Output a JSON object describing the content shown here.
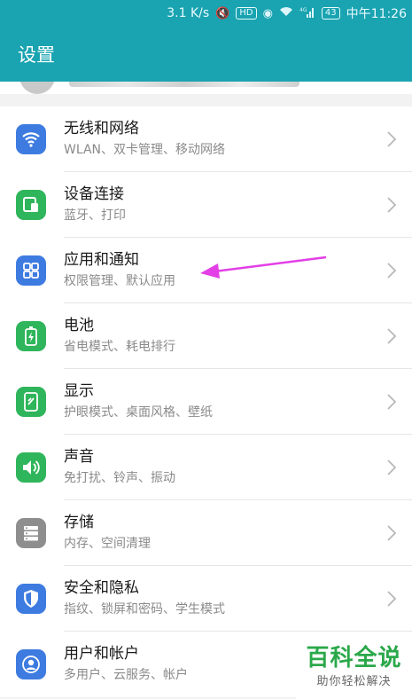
{
  "status_bar": {
    "speed": "3.1 K/s",
    "network": "4G",
    "hd": "HD",
    "battery": "43",
    "time": "中午11:26"
  },
  "header": {
    "title": "设置"
  },
  "settings": [
    {
      "title": "无线和网络",
      "subtitle": "WLAN、双卡管理、移动网络",
      "icon": "wifi-icon",
      "color": "#3d7be0"
    },
    {
      "title": "设备连接",
      "subtitle": "蓝牙、打印",
      "icon": "device-connect-icon",
      "color": "#2fb55b"
    },
    {
      "title": "应用和通知",
      "subtitle": "权限管理、默认应用",
      "icon": "apps-grid-icon",
      "color": "#3d7be0"
    },
    {
      "title": "电池",
      "subtitle": "省电模式、耗电排行",
      "icon": "battery-icon",
      "color": "#2fb55b"
    },
    {
      "title": "显示",
      "subtitle": "护眼模式、桌面风格、壁纸",
      "icon": "display-icon",
      "color": "#2fb55b"
    },
    {
      "title": "声音",
      "subtitle": "免打扰、铃声、振动",
      "icon": "sound-icon",
      "color": "#2fb55b"
    },
    {
      "title": "存储",
      "subtitle": "内存、空间清理",
      "icon": "storage-icon",
      "color": "#8e8e8e"
    },
    {
      "title": "安全和隐私",
      "subtitle": "指纹、锁屏和密码、学生模式",
      "icon": "shield-icon",
      "color": "#3d7be0"
    },
    {
      "title": "用户和帐户",
      "subtitle": "多用户、云服务、帐户",
      "icon": "user-icon",
      "color": "#3d7be0"
    }
  ],
  "watermark": {
    "main": "百科全说",
    "sub": "助你轻松解决"
  },
  "colors": {
    "accent": "#1aa3b0",
    "annotation": "#e23fe6"
  }
}
